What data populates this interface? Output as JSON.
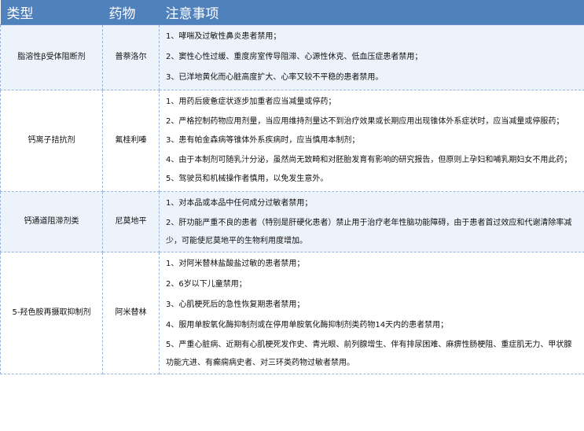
{
  "header": {
    "col_type": "类型",
    "col_drug": "药物",
    "col_notes": "注意事项"
  },
  "rows": [
    {
      "type": "脂溶性β受体阻断剂",
      "drug": "普萘洛尔",
      "notes": [
        "1、哮喘及过敏性鼻炎患者禁用；",
        "2、窦性心性过缓、重度房室传导阻滞、心源性休克、低血压症患者禁用；",
        "3、已洋地黄化而心脏高度扩大、心率又较不平稳的患者禁用。"
      ]
    },
    {
      "type": "钙离子拮抗剂",
      "drug": "氟桂利嗪",
      "notes": [
        "1、用药后疲惫症状逐步加重者应当减量或停药；",
        "2、严格控制药物应用剂量，当应用维持剂量达不到治疗效果或长期应用出现锥体外系症状时，应当减量或停服药；",
        "3、患有帕金森病等锥体外系疾病时，应当慎用本制剂；",
        "4、由于本制剂可随乳汁分泌，虽然尚无致畸和对胚胎发育有影响的研究报告，但原则上孕妇和哺乳期妇女不用此药；",
        "5、驾驶员和机械操作者慎用，以免发生意外。"
      ]
    },
    {
      "type": "钙通道阻滞剂类",
      "drug": "尼莫地平",
      "notes": [
        "1、对本品或本品中任何成分过敏者禁用；",
        "2、肝功能严重不良的患者（特别是肝硬化患者）禁止用于治疗老年性脑功能障碍，由于患者首过效应和代谢清除率减少，可能使尼莫地平的生物利用度增加。"
      ]
    },
    {
      "type": "5-羟色胺再摄取抑制剂",
      "drug": "阿米替林",
      "notes": [
        "1、对阿米替林盐酸盐过敏的患者禁用；",
        "2、6岁以下儿童禁用；",
        "3、心肌梗死后的急性恢复期患者禁用；",
        "4、服用单胺氧化酶抑制剂或在停用单胺氧化酶抑制剂类药物14天内的患者禁用；",
        "5、严重心脏病、近期有心肌梗死发作史、青光眼、前列腺增生、伴有排尿困难、麻痹性肠梗阻、重症肌无力、甲状腺功能亢进、有癫痫病史者、对三环类药物过敏者禁用。"
      ]
    }
  ]
}
